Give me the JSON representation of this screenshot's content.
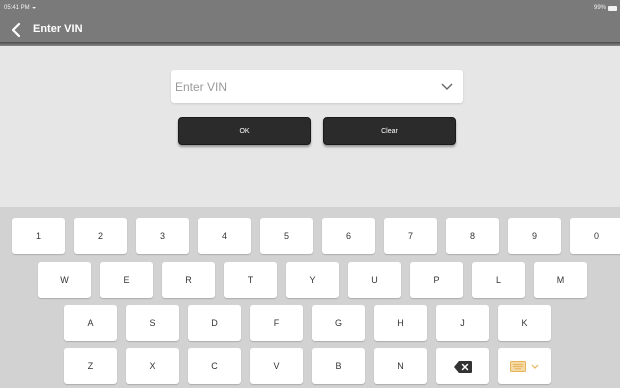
{
  "status": {
    "time": "05:41 PM",
    "battery": "99%"
  },
  "header": {
    "title": "Enter VIN"
  },
  "vin": {
    "placeholder": "Enter VIN",
    "value": ""
  },
  "buttons": {
    "ok": "OK",
    "clear": "Clear"
  },
  "keyboard": {
    "row1": [
      "1",
      "2",
      "3",
      "4",
      "5",
      "6",
      "7",
      "8",
      "9",
      "0"
    ],
    "row2": [
      "W",
      "E",
      "R",
      "T",
      "Y",
      "U",
      "P",
      "L",
      "M"
    ],
    "row3": [
      "A",
      "S",
      "D",
      "F",
      "G",
      "H",
      "J",
      "K"
    ],
    "row4": [
      "Z",
      "X",
      "C",
      "V",
      "B",
      "N"
    ],
    "icons": {
      "backspace": "backspace-icon",
      "keyboard": "keyboard-icon"
    },
    "accent": "#e8b45a"
  }
}
